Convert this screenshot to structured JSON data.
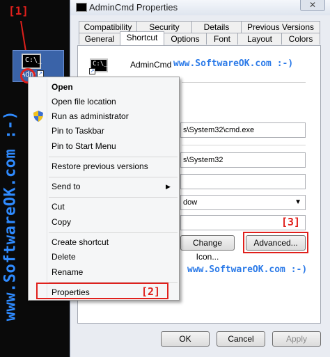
{
  "markers": {
    "m1": "[1]",
    "m2": "[2]",
    "m3": "[3]"
  },
  "watermark": {
    "vertical": "www.SoftwareOK.com :-)",
    "top": "www.SoftwareOK.com :-)",
    "bottom": "www.SoftwareOK.com :-)"
  },
  "desktop_icon": {
    "glyph": "C:\\_",
    "label": "Adm"
  },
  "dialog": {
    "title": "AdminCmd Properties",
    "close": "✕",
    "tabs_row1": [
      "Compatibility",
      "Security",
      "Details",
      "Previous Versions"
    ],
    "tabs_row2": [
      "General",
      "Shortcut",
      "Options",
      "Font",
      "Layout",
      "Colors"
    ],
    "active_tab": "Shortcut",
    "app_name": "AdminCmd",
    "target_value": "s\\System32\\cmd.exe",
    "start_in_value": "s\\System32",
    "hotkey_value": "",
    "run_value": "dow",
    "comment_value": "",
    "change_icon": "Change Icon...",
    "advanced": "Advanced...",
    "ok": "OK",
    "cancel": "Cancel",
    "apply": "Apply"
  },
  "context_menu": {
    "open": "Open",
    "open_file_location": "Open file location",
    "run_as_admin": "Run as administrator",
    "pin_taskbar": "Pin to Taskbar",
    "pin_start": "Pin to Start Menu",
    "restore": "Restore previous versions",
    "send_to": "Send to",
    "cut": "Cut",
    "copy": "Copy",
    "create_shortcut": "Create shortcut",
    "delete": "Delete",
    "rename": "Rename",
    "properties": "Properties"
  },
  "colors": {
    "annotation_red": "#e0201c",
    "watermark_blue": "#2b7ae8"
  }
}
